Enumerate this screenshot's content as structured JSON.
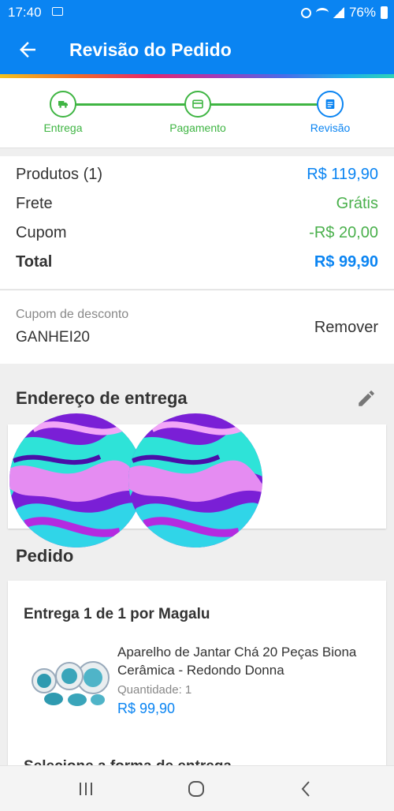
{
  "status": {
    "time": "17:40",
    "battery": "76%"
  },
  "appbar": {
    "title": "Revisão do Pedido"
  },
  "stepper": {
    "steps": [
      {
        "label": "Entrega"
      },
      {
        "label": "Pagamento"
      },
      {
        "label": "Revisão"
      }
    ]
  },
  "summary": {
    "products_label": "Produtos (1)",
    "products_value": "R$ 119,90",
    "shipping_label": "Frete",
    "shipping_value": "Grátis",
    "coupon_label": "Cupom",
    "coupon_value": "-R$ 20,00",
    "total_label": "Total",
    "total_value": "R$ 99,90"
  },
  "coupon": {
    "label": "Cupom de desconto",
    "code": "GANHEI20",
    "remove": "Remover"
  },
  "address": {
    "title": "Endereço de entrega"
  },
  "order": {
    "title": "Pedido",
    "delivery": "Entrega 1 de 1 por Magalu",
    "product_name": "Aparelho de Jantar Chá 20 Peças Biona Cerâmica - Redondo Donna",
    "quantity": "Quantidade:  1",
    "price": "R$ 99,90",
    "next_section_partial": "Selecione a forma de entrega"
  },
  "colors": {
    "primary": "#0a84f2",
    "success": "#3fb543",
    "accent_green": "#4ab04c"
  },
  "icons": [
    "back-arrow-icon",
    "truck-icon",
    "card-icon",
    "list-icon",
    "edit-pencil-icon",
    "nav-recents-icon",
    "nav-home-icon",
    "nav-back-icon"
  ]
}
